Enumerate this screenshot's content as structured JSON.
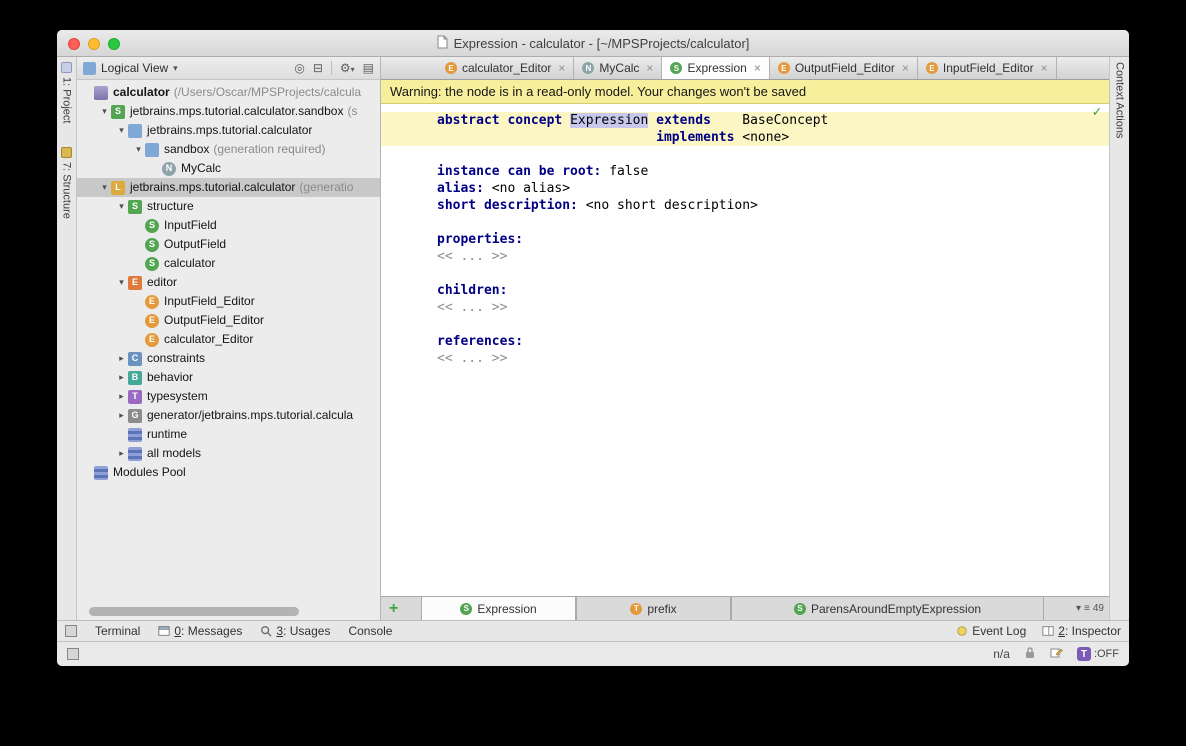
{
  "window": {
    "title": "Expression - calculator - [~/MPSProjects/calculator]"
  },
  "left_stripe": {
    "project": "1: Project",
    "structure": "7: Structure"
  },
  "right_stripe": {
    "context_actions": "Context Actions"
  },
  "colors": {
    "warning_bg": "#f7ef9b",
    "keyword": "#000084",
    "concept_green": "#53a553",
    "editor_orange": "#e49a3a",
    "selection": "#c8c8ef",
    "line_highlight": "#fcf6c5"
  },
  "project_panel": {
    "header": {
      "view_label": "Logical View"
    },
    "tree": [
      {
        "depth": 0,
        "arrow": "none",
        "icon": "project",
        "label": "calculator",
        "suffix": " (/Users/Oscar/MPSProjects/calcula",
        "bold": true
      },
      {
        "depth": 1,
        "arrow": "expanded",
        "icon": "solution",
        "label": "jetbrains.mps.tutorial.calculator.sandbox",
        "suffix": " (s"
      },
      {
        "depth": 2,
        "arrow": "expanded",
        "icon": "folder",
        "label": "jetbrains.mps.tutorial.calculator"
      },
      {
        "depth": 3,
        "arrow": "expanded",
        "icon": "folder",
        "label": "sandbox",
        "suffix": " (generation required)"
      },
      {
        "depth": 4,
        "arrow": "none",
        "icon": "node",
        "label": "MyCalc"
      },
      {
        "depth": 1,
        "arrow": "expanded",
        "icon": "language",
        "label": "jetbrains.mps.tutorial.calculator",
        "suffix": " (generatio",
        "selected": true
      },
      {
        "depth": 2,
        "arrow": "expanded",
        "icon": "structure",
        "label": "structure"
      },
      {
        "depth": 3,
        "arrow": "none",
        "icon": "concept",
        "label": "InputField"
      },
      {
        "depth": 3,
        "arrow": "none",
        "icon": "concept",
        "label": "OutputField"
      },
      {
        "depth": 3,
        "arrow": "none",
        "icon": "concept",
        "label": "calculator"
      },
      {
        "depth": 2,
        "arrow": "expanded",
        "icon": "editorA",
        "label": "editor"
      },
      {
        "depth": 3,
        "arrow": "none",
        "icon": "editorC",
        "label": "InputField_Editor"
      },
      {
        "depth": 3,
        "arrow": "none",
        "icon": "editorC",
        "label": "OutputField_Editor"
      },
      {
        "depth": 3,
        "arrow": "none",
        "icon": "editorC",
        "label": "calculator_Editor"
      },
      {
        "depth": 2,
        "arrow": "collapsed",
        "icon": "constraints",
        "label": "constraints"
      },
      {
        "depth": 2,
        "arrow": "collapsed",
        "icon": "behavior",
        "label": "behavior"
      },
      {
        "depth": 2,
        "arrow": "collapsed",
        "icon": "typesystem",
        "label": "typesystem"
      },
      {
        "depth": 2,
        "arrow": "collapsed",
        "icon": "generator",
        "label": "generator/jetbrains.mps.tutorial.calcula"
      },
      {
        "depth": 2,
        "arrow": "none",
        "icon": "runtime",
        "label": "runtime"
      },
      {
        "depth": 2,
        "arrow": "collapsed",
        "icon": "models",
        "label": "all models"
      },
      {
        "depth": 0,
        "arrow": "none",
        "icon": "pool",
        "label": "Modules Pool"
      }
    ]
  },
  "editor": {
    "tabs": [
      {
        "label": "calculator_Editor",
        "icon": "E",
        "kind": "editor"
      },
      {
        "label": "MyCalc",
        "icon": "N",
        "kind": "node"
      },
      {
        "label": "Expression",
        "icon": "S",
        "kind": "concept",
        "active": true
      },
      {
        "label": "OutputField_Editor",
        "icon": "E",
        "kind": "editor"
      },
      {
        "label": "InputField_Editor",
        "icon": "E",
        "kind": "editor"
      }
    ],
    "warning": "Warning: the node is in a read-only model. Your changes won't be saved",
    "lines": [
      {
        "hl": true,
        "seg": [
          {
            "t": "abstract concept ",
            "s": "kw"
          },
          {
            "t": "Expression",
            "s": "sel"
          },
          {
            "t": " ",
            "s": "p"
          },
          {
            "t": "extends",
            "s": "kw"
          },
          {
            "t": "    ",
            "s": "p"
          },
          {
            "t": "BaseConcept",
            "s": "p"
          }
        ]
      },
      {
        "hl": true,
        "indent": 28,
        "seg": [
          {
            "t": "implements ",
            "s": "kw"
          },
          {
            "t": "<none>",
            "s": "p"
          }
        ]
      },
      {
        "blank": true
      },
      {
        "seg": [
          {
            "t": "instance can be root: ",
            "s": "kw"
          },
          {
            "t": "false",
            "s": "p"
          }
        ]
      },
      {
        "seg": [
          {
            "t": "alias: ",
            "s": "kw"
          },
          {
            "t": "<no alias>",
            "s": "p"
          }
        ]
      },
      {
        "seg": [
          {
            "t": "short description: ",
            "s": "kw"
          },
          {
            "t": "<no short description>",
            "s": "p"
          }
        ]
      },
      {
        "blank": true
      },
      {
        "seg": [
          {
            "t": "properties:",
            "s": "kw"
          }
        ]
      },
      {
        "seg": [
          {
            "t": "<< ... >>",
            "s": "dim"
          }
        ]
      },
      {
        "blank": true
      },
      {
        "seg": [
          {
            "t": "children:",
            "s": "kw"
          }
        ]
      },
      {
        "seg": [
          {
            "t": "<< ... >>",
            "s": "dim"
          }
        ]
      },
      {
        "blank": true
      },
      {
        "seg": [
          {
            "t": "references:",
            "s": "kw"
          }
        ]
      },
      {
        "seg": [
          {
            "t": "<< ... >>",
            "s": "dim"
          }
        ]
      }
    ],
    "bottom_tabs": [
      {
        "label": "Expression",
        "icon": "S",
        "kind": "concept",
        "active": true
      },
      {
        "label": "prefix",
        "icon": "T",
        "kind": "text"
      },
      {
        "label": "ParensAroundEmptyExpression",
        "icon": "S",
        "kind": "concept"
      }
    ],
    "hidden_tabs_count": "49"
  },
  "bottom_bar": {
    "left": [
      {
        "label": "Terminal"
      },
      {
        "icon": "messages",
        "mnemonic": "0",
        "label": ": Messages"
      },
      {
        "icon": "usages",
        "mnemonic": "3",
        "label": ": Usages"
      },
      {
        "label": "Console"
      }
    ],
    "right": [
      {
        "icon": "event-log",
        "label": "Event Log"
      },
      {
        "icon": "inspector",
        "mnemonic": "2",
        "label": ": Inspector"
      }
    ]
  },
  "statusbar": {
    "na": "n/a",
    "t_label": "T",
    "toff": ":OFF"
  }
}
